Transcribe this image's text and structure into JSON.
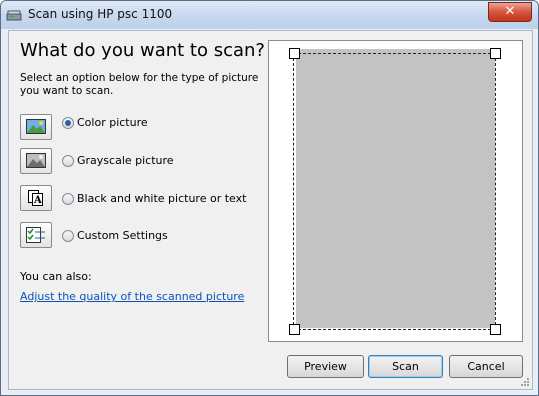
{
  "window": {
    "title": "Scan using HP psc 1100",
    "close_glyph": "✕"
  },
  "dialog": {
    "heading": "What do you want to scan?",
    "description": "Select an option below for the type of picture you want to scan.",
    "options": [
      {
        "label": "Color picture",
        "selected": true,
        "icon": "color-picture-icon"
      },
      {
        "label": "Grayscale picture",
        "selected": false,
        "icon": "grayscale-picture-icon"
      },
      {
        "label": "Black and white picture or text",
        "selected": false,
        "icon": "bw-picture-icon"
      },
      {
        "label": "Custom Settings",
        "selected": false,
        "icon": "custom-settings-icon"
      }
    ],
    "also_label": "You can also:",
    "adjust_link": "Adjust the quality of the scanned picture"
  },
  "buttons": {
    "preview": "Preview",
    "scan": "Scan",
    "cancel": "Cancel"
  },
  "colors": {
    "link": "#0b53b8",
    "scan_page": "#c3c3c3",
    "close": "#d8543d"
  }
}
